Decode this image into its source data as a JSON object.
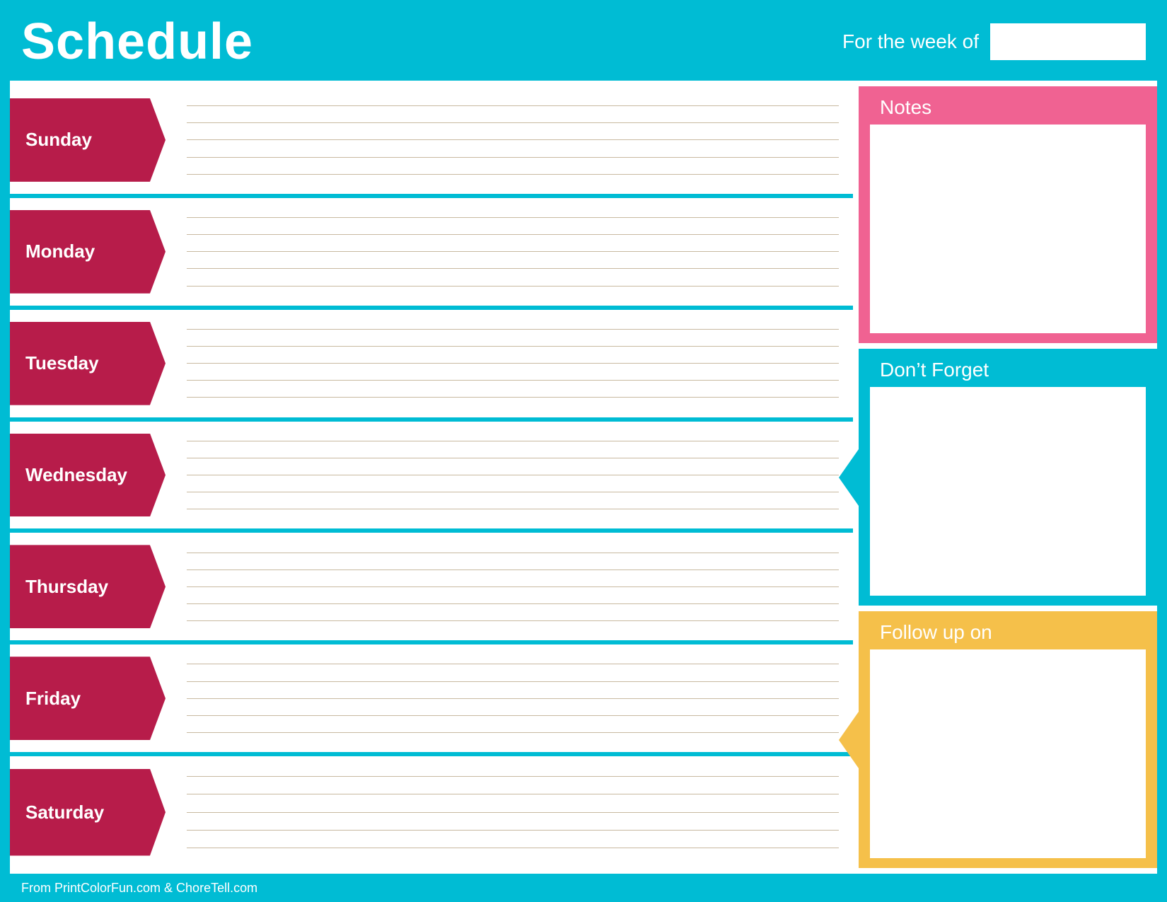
{
  "header": {
    "title": "Schedule",
    "week_of_label": "For the week of",
    "week_of_value": ""
  },
  "days": [
    {
      "label": "Sunday",
      "lines": 5
    },
    {
      "label": "Monday",
      "lines": 5
    },
    {
      "label": "Tuesday",
      "lines": 5
    },
    {
      "label": "Wednesday",
      "lines": 5
    },
    {
      "label": "Thursday",
      "lines": 5
    },
    {
      "label": "Friday",
      "lines": 5
    },
    {
      "label": "Saturday",
      "lines": 5
    }
  ],
  "notes": {
    "header": "Notes",
    "placeholder": ""
  },
  "dont_forget": {
    "header": "Don’t Forget",
    "placeholder": ""
  },
  "follow_up": {
    "header": "Follow up on",
    "placeholder": ""
  },
  "footer": {
    "text": "From PrintColorFun.com & ChoreTell.com"
  },
  "colors": {
    "teal": "#00BCD4",
    "crimson": "#B71C4A",
    "pink": "#F06292",
    "gold": "#F5C04A",
    "white": "#ffffff"
  }
}
